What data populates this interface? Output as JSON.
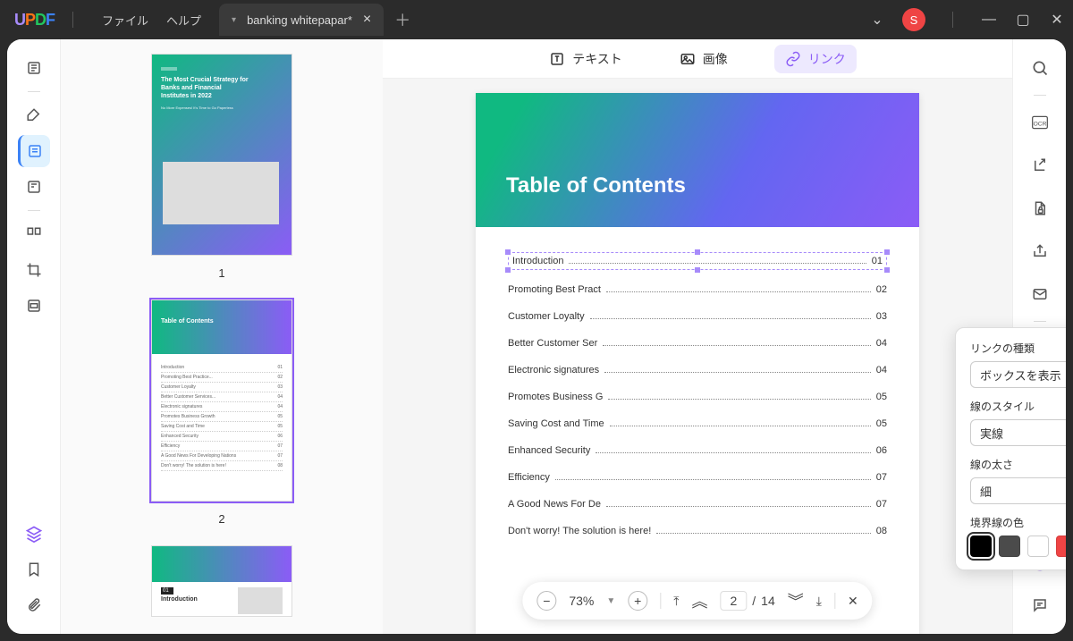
{
  "menu": {
    "file": "ファイル",
    "help": "ヘルプ"
  },
  "tab": {
    "title": "banking whitepapar*"
  },
  "avatar": "S",
  "thumbnails": {
    "n1": "1",
    "n2": "2"
  },
  "thumb1": {
    "title": "The Most Crucial Strategy for Banks and Financial Institutes in 2022",
    "sub": "No More Expenses! It's Time to Go Paperless"
  },
  "thumb2": {
    "title": "Table of Contents"
  },
  "toptools": {
    "text": "テキスト",
    "image": "画像",
    "link": "リンク"
  },
  "page": {
    "title": "Table of Contents"
  },
  "toc": [
    {
      "t": "Introduction",
      "n": "01"
    },
    {
      "t": "Promoting Best Pract",
      "n": "02"
    },
    {
      "t": "Customer Loyalty",
      "n": "03"
    },
    {
      "t": "Better Customer Ser",
      "n": "04"
    },
    {
      "t": "Electronic signatures",
      "n": "04"
    },
    {
      "t": "Promotes Business G",
      "n": "05"
    },
    {
      "t": "Saving Cost and Time",
      "n": "05"
    },
    {
      "t": "Enhanced Security",
      "n": "06"
    },
    {
      "t": "Efficiency",
      "n": "07"
    },
    {
      "t": "A Good News For De",
      "n": "07"
    },
    {
      "t": "Don't worry! The solution is here!",
      "n": "08"
    }
  ],
  "popup": {
    "type_label": "リンクの種類",
    "type_value": "ボックスを表示",
    "style_label": "線のスタイル",
    "style_value": "実線",
    "weight_label": "線の太さ",
    "weight_value": "細",
    "color_label": "境界線の色",
    "colors": [
      "#000000",
      "#4b4b4b",
      "#ffffff",
      "#ef4444",
      "#fbbf24",
      "#2dd4bf"
    ]
  },
  "bottombar": {
    "zoom": "73%",
    "page": "2",
    "sep": "/",
    "total": "14"
  }
}
